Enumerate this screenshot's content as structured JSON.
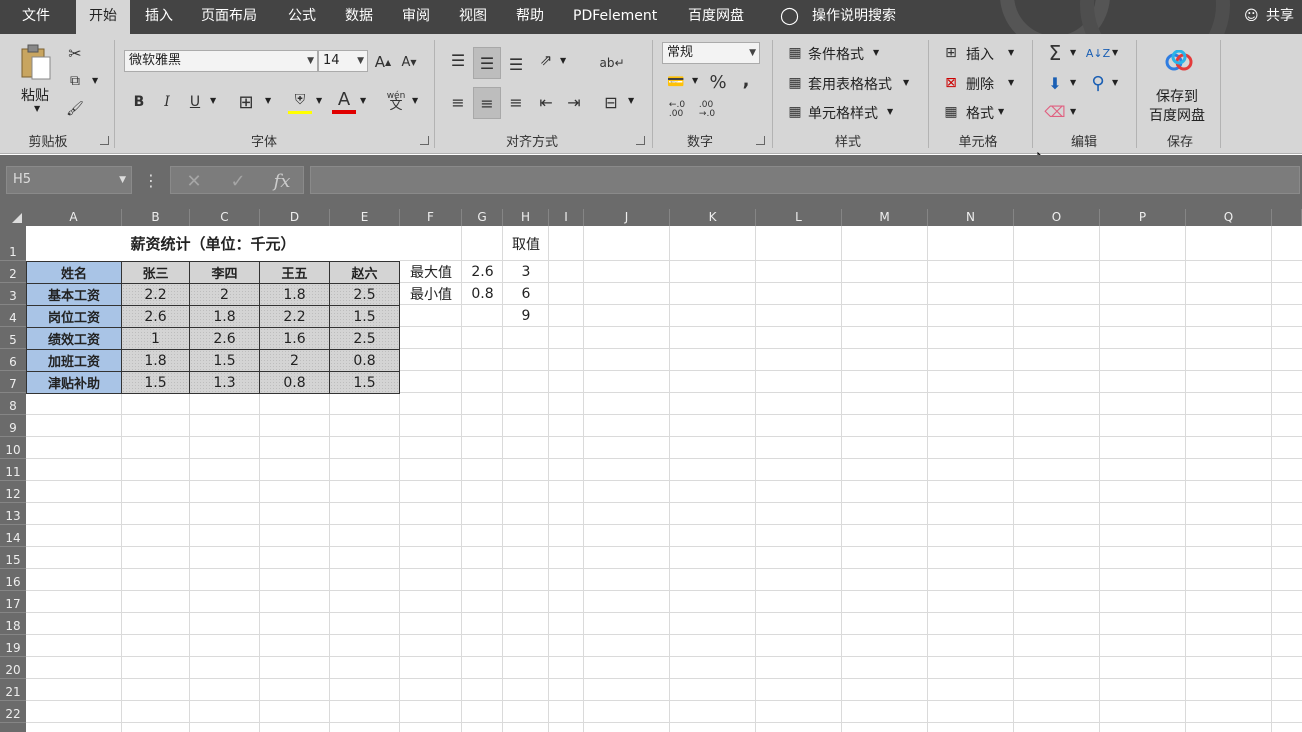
{
  "menu": {
    "tabs": [
      "文件",
      "开始",
      "插入",
      "页面布局",
      "公式",
      "数据",
      "审阅",
      "视图",
      "帮助",
      "PDFelement",
      "百度网盘"
    ],
    "active": "开始",
    "tell_me": "操作说明搜索",
    "share": "共享"
  },
  "ribbon": {
    "clipboard": {
      "paste": "粘贴",
      "group": "剪贴板"
    },
    "font": {
      "name": "微软雅黑",
      "size": "14",
      "bold": "B",
      "italic": "I",
      "underline": "U",
      "font_color_glyph": "A",
      "increase": "A",
      "decrease": "A",
      "pinyin": "wén",
      "group": "字体"
    },
    "alignment": {
      "group": "对齐方式"
    },
    "number": {
      "format": "常规",
      "percent": "%",
      "comma": ",",
      "group": "数字"
    },
    "styles": {
      "conditional": "条件格式",
      "table": "套用表格格式",
      "cell": "单元格样式",
      "group": "样式"
    },
    "cells": {
      "insert": "插入",
      "delete": "删除",
      "format": "格式",
      "group": "单元格"
    },
    "editing": {
      "group": "编辑"
    },
    "save": {
      "line1": "保存到",
      "line2": "百度网盘",
      "group": "保存"
    }
  },
  "formula_bar": {
    "name_box": "H5",
    "value": ""
  },
  "sheet": {
    "columns": [
      "A",
      "B",
      "C",
      "D",
      "E",
      "F",
      "G",
      "H",
      "I",
      "J",
      "K",
      "L",
      "M",
      "N",
      "O",
      "P",
      "Q"
    ],
    "rows": [
      "1",
      "2",
      "3",
      "4",
      "5",
      "6",
      "7",
      "8",
      "9",
      "10",
      "11",
      "12",
      "13",
      "14",
      "15",
      "16",
      "17",
      "18",
      "19",
      "20",
      "21",
      "22"
    ],
    "title": "薪资统计（单位：千元）",
    "table_corner": "姓名",
    "table_headers": [
      "张三",
      "李四",
      "王五",
      "赵六"
    ],
    "table_rows": [
      {
        "label": "基本工资",
        "values": [
          "2.2",
          "2",
          "1.8",
          "2.5"
        ]
      },
      {
        "label": "岗位工资",
        "values": [
          "2.6",
          "1.8",
          "2.2",
          "1.5"
        ]
      },
      {
        "label": "绩效工资",
        "values": [
          "1",
          "2.6",
          "1.6",
          "2.5"
        ]
      },
      {
        "label": "加班工资",
        "values": [
          "1.8",
          "1.5",
          "2",
          "0.8"
        ]
      },
      {
        "label": "津贴补助",
        "values": [
          "1.5",
          "1.3",
          "0.8",
          "1.5"
        ]
      }
    ],
    "max_label": "最大值",
    "max_value": "2.6",
    "min_label": "最小值",
    "min_value": "0.8",
    "pick_header": "取值",
    "pick_values": [
      "3",
      "6",
      "9"
    ]
  }
}
